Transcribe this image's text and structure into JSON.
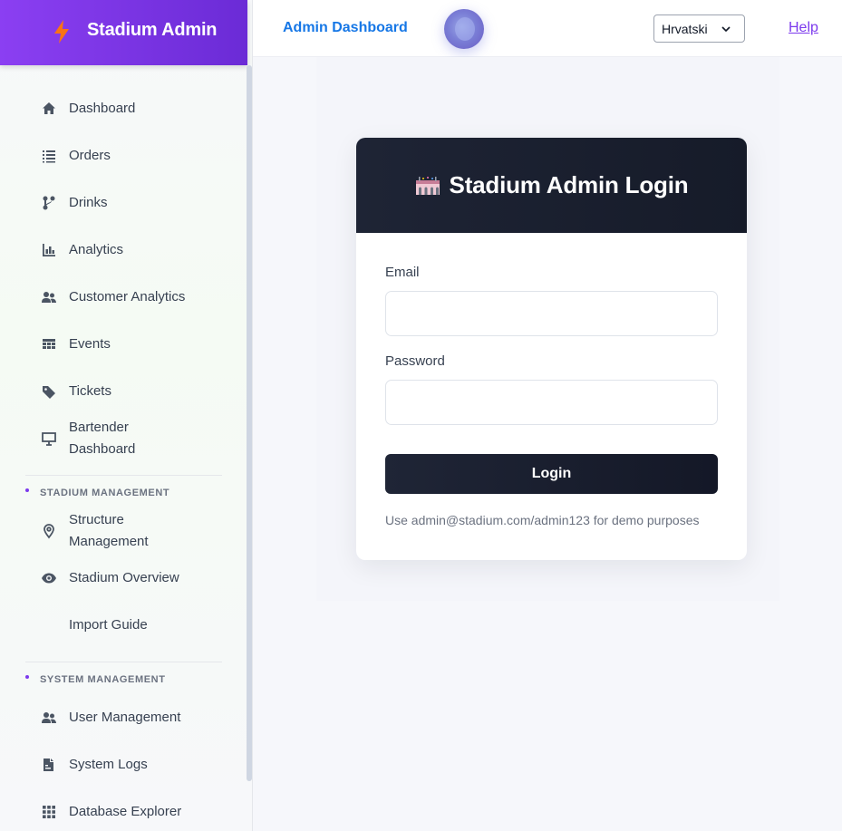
{
  "sidebar": {
    "brand": "Stadium Admin",
    "items": [
      {
        "label": "Dashboard",
        "icon": "home-icon"
      },
      {
        "label": "Orders",
        "icon": "list-icon"
      },
      {
        "label": "Drinks",
        "icon": "drinks-icon"
      },
      {
        "label": "Analytics",
        "icon": "bar-chart-icon"
      },
      {
        "label": "Customer Analytics",
        "icon": "people-icon"
      },
      {
        "label": "Events",
        "icon": "calendar-icon"
      },
      {
        "label": "Tickets",
        "icon": "tag-icon"
      },
      {
        "label_line1": "Bartender",
        "label_line2": "Dashboard",
        "icon": "monitor-icon"
      }
    ],
    "section_stadium": "STADIUM MANAGEMENT",
    "stadium_items": [
      {
        "label_line1": "Structure",
        "label_line2": "Management",
        "icon": "location-pin-icon"
      },
      {
        "label": "Stadium Overview",
        "icon": "eye-icon"
      },
      {
        "label": "Import Guide",
        "icon": ""
      }
    ],
    "section_system": "SYSTEM MANAGEMENT",
    "system_items": [
      {
        "label": "User Management",
        "icon": "people-icon"
      },
      {
        "label": "System Logs",
        "icon": "logs-icon"
      },
      {
        "label": "Database Explorer",
        "icon": "grid-icon"
      }
    ]
  },
  "header": {
    "title": "Admin Dashboard",
    "language": "Hrvatski",
    "help": "Help"
  },
  "login": {
    "title": "Stadium Admin Login",
    "email_label": "Email",
    "email_value": "",
    "password_label": "Password",
    "password_value": "",
    "button": "Login",
    "hint": "Use admin@stadium.com/admin123 for demo purposes"
  },
  "colors": {
    "brand_purple": "#7c3aed",
    "accent_blue": "#1677e6",
    "dark_navy": "#1a1f2e"
  }
}
